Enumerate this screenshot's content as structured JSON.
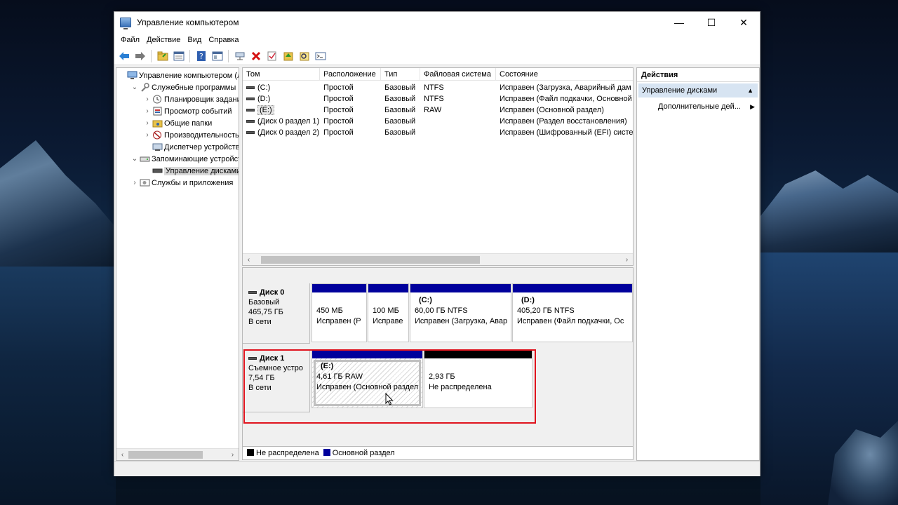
{
  "window": {
    "title": "Управление компьютером",
    "controls": {
      "minimize": "—",
      "maximize": "☐",
      "close": "✕"
    }
  },
  "menu": [
    "Файл",
    "Действие",
    "Вид",
    "Справка"
  ],
  "toolbar_icons": [
    "back-arrow-icon",
    "forward-arrow-icon",
    "folder-icon",
    "properties-icon",
    "help-icon",
    "view-icon",
    "connect-icon",
    "delete-icon",
    "check-icon",
    "up-icon",
    "find-icon",
    "console-icon"
  ],
  "tree": [
    {
      "label": "Управление компьютером (л",
      "expander": "",
      "indent": 0,
      "icon": "computer-icon"
    },
    {
      "label": "Служебные программы",
      "expander": "⌄",
      "indent": 1,
      "icon": "tools-icon"
    },
    {
      "label": "Планировщик заданий",
      "expander": "›",
      "indent": 2,
      "icon": "clock-icon"
    },
    {
      "label": "Просмотр событий",
      "expander": "›",
      "indent": 2,
      "icon": "event-viewer-icon"
    },
    {
      "label": "Общие папки",
      "expander": "›",
      "indent": 2,
      "icon": "shared-folder-icon"
    },
    {
      "label": "Производительность",
      "expander": "›",
      "indent": 2,
      "icon": "performance-icon"
    },
    {
      "label": "Диспетчер устройств",
      "expander": "",
      "indent": 2,
      "icon": "device-manager-icon"
    },
    {
      "label": "Запоминающие устройст",
      "expander": "⌄",
      "indent": 1,
      "icon": "storage-icon"
    },
    {
      "label": "Управление дисками",
      "expander": "",
      "indent": 2,
      "icon": "disk-management-icon",
      "selected": true
    },
    {
      "label": "Службы и приложения",
      "expander": "›",
      "indent": 1,
      "icon": "services-icon"
    }
  ],
  "volumes": {
    "columns": [
      "Том",
      "Расположение",
      "Тип",
      "Файловая система",
      "Состояние"
    ],
    "rows": [
      {
        "name": "(C:)",
        "layout": "Простой",
        "type": "Базовый",
        "fs": "NTFS",
        "status": "Исправен (Загрузка, Аварийный дам"
      },
      {
        "name": "(D:)",
        "layout": "Простой",
        "type": "Базовый",
        "fs": "NTFS",
        "status": "Исправен (Файл подкачки, Основной"
      },
      {
        "name": "(E:)",
        "layout": "Простой",
        "type": "Базовый",
        "fs": "RAW",
        "status": "Исправен (Основной раздел)",
        "selected": true
      },
      {
        "name": "(Диск 0 раздел 1)",
        "layout": "Простой",
        "type": "Базовый",
        "fs": "",
        "status": "Исправен (Раздел восстановления)"
      },
      {
        "name": "(Диск 0 раздел 2)",
        "layout": "Простой",
        "type": "Базовый",
        "fs": "",
        "status": "Исправен (Шифрованный (EFI) систе"
      }
    ]
  },
  "disks": [
    {
      "title": "Диск 0",
      "kind": "Базовый",
      "size": "465,75 ГБ",
      "state": "В сети",
      "partitions": [
        {
          "name": "",
          "line1": "450 МБ",
          "line2": "Исправен (Р",
          "bar": "#00009c"
        },
        {
          "name": "",
          "line1": "100 МБ",
          "line2": "Исправе",
          "bar": "#00009c"
        },
        {
          "name": "(C:)",
          "line1": "60,00 ГБ NTFS",
          "line2": "Исправен (Загрузка, Авар",
          "bar": "#00009c"
        },
        {
          "name": "(D:)",
          "line1": "405,20 ГБ NTFS",
          "line2": "Исправен (Файл подкачки, Ос",
          "bar": "#00009c"
        }
      ]
    },
    {
      "title": "Диск 1",
      "kind": "Съемное устро",
      "size": "7,54 ГБ",
      "state": "В сети",
      "partitions": [
        {
          "name": "(E:)",
          "line1": "4,61 ГБ RAW",
          "line2": "Исправен (Основной раздел",
          "bar": "#00009c"
        },
        {
          "name": "",
          "line1": "2,93 ГБ",
          "line2": "Не распределена",
          "bar": "#000000"
        }
      ]
    }
  ],
  "legend": [
    {
      "label": "Не распределена",
      "color": "#000000"
    },
    {
      "label": "Основной раздел",
      "color": "#00009c"
    }
  ],
  "actions": {
    "title": "Действия",
    "section": "Управление дисками",
    "item": "Дополнительные дей..."
  },
  "colors": {
    "selection_blue": "#d7e4f2",
    "highlight_red": "#e0141e",
    "primary_partition": "#00009c"
  }
}
